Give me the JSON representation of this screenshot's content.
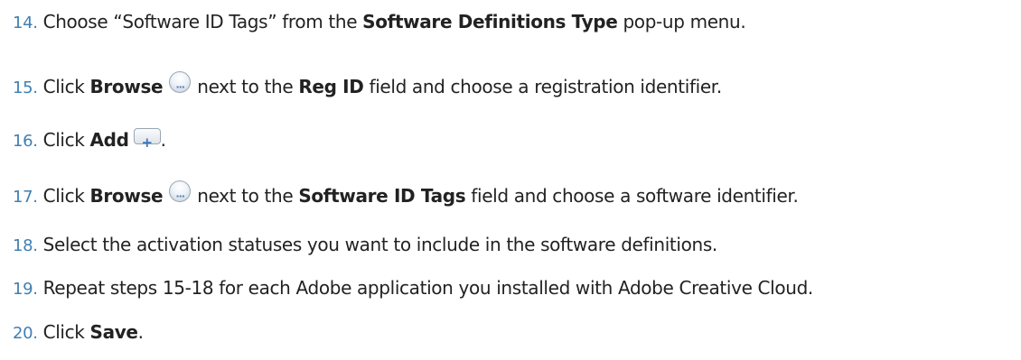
{
  "steps": [
    {
      "num": "14.",
      "t1": "Choose “Software ID Tags” from the ",
      "b1": "Software Definitions Type",
      "t2": " pop-up menu."
    },
    {
      "num": "15.",
      "t1": "Click ",
      "b1": "Browse",
      "icon": "browse-icon",
      "t2": " next to the ",
      "b2": "Reg ID",
      "t3": " field and choose a registration identifier."
    },
    {
      "num": "16.",
      "t1": "Click ",
      "b1": "Add",
      "icon": "add-icon",
      "t2": "."
    },
    {
      "num": "17.",
      "t1": "Click ",
      "b1": "Browse",
      "icon": "browse-icon",
      "t2": " next to the ",
      "b2": "Software ID Tags",
      "t3": " field and choose a software identifier."
    },
    {
      "num": "18.",
      "t1": "Select the activation statuses you want to include in the software definitions."
    },
    {
      "num": "19.",
      "t1": "Repeat steps 15-18 for each Adobe application you installed with Adobe Creative Cloud."
    },
    {
      "num": "20.",
      "t1": "Click ",
      "b1": "Save",
      "t2": "."
    }
  ]
}
